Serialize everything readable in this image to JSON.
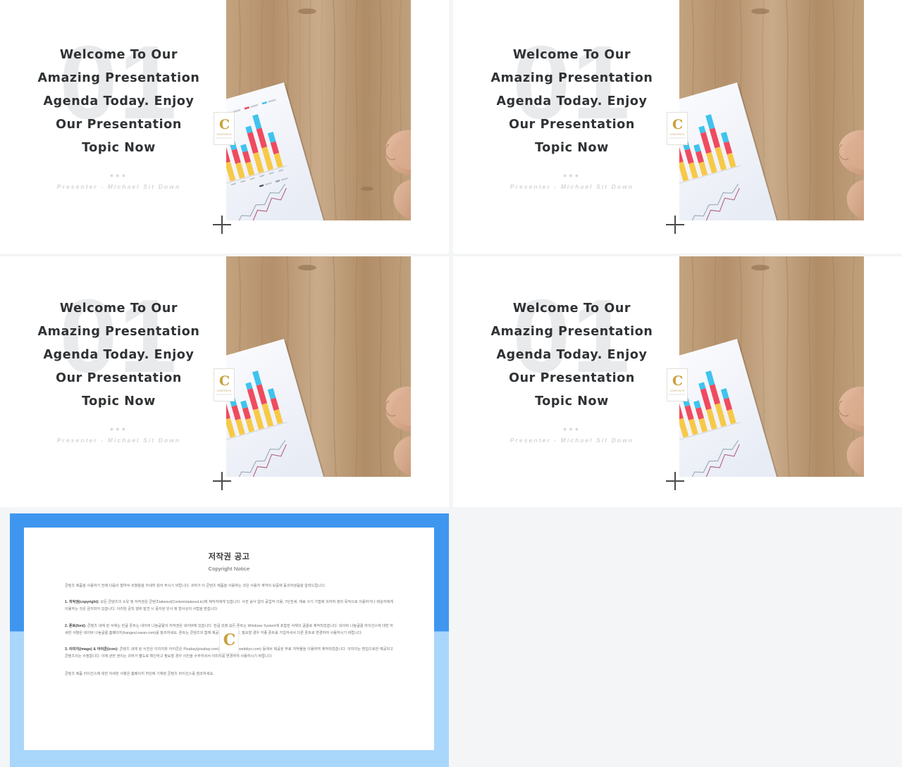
{
  "meta": {
    "background_color": "#f4f5f7",
    "slide_background": "#ffffff",
    "accent_blue_dark": "#3f96ef",
    "accent_blue_light": "#a9d6fb",
    "gold": "#c9a13c"
  },
  "slide": {
    "watermark_number": "01",
    "title_lines": [
      "Welcome To Our",
      "Amazing Presentation",
      "Agenda Today. Enjoy",
      "Our Presentation",
      "Topic Now"
    ],
    "dots": "●●●",
    "presenter": "Presenter - Michael Sit Down",
    "logo": {
      "mark": "C",
      "line1": "CONTENTS",
      "line2": "PRESENTATION"
    },
    "plus_marker": "plus-marker-icon",
    "photo_alt": "wooden-desk-with-bar-chart-report-and-hand"
  },
  "slides": [
    {
      "index": 1,
      "position": "top-left"
    },
    {
      "index": 2,
      "position": "top-right"
    },
    {
      "index": 3,
      "position": "bottom-left"
    },
    {
      "index": 4,
      "position": "bottom-right"
    }
  ],
  "copyright_notice": {
    "title_ko": "저작권 공고",
    "title_en": "Copyright Notice",
    "intro": "콘텐츠 제품을 사용하기 전에 다음의 협약서 조항들을 자세히 읽어 주시기 바랍니다. 귀하가 이 콘텐츠 제품을 사용하는 것은 사용자 계약의 보증에 동의하셨음을 알려드립니다.",
    "items": [
      {
        "label": "1. 저작권(copyright):",
        "text": "모든 콘텐츠의 소유 및 저작권은 콘텐츠takeout(Contentstakeout.kr)에 제작자에게 있습니다. 사전 승낙 없이 공업적 이용, 7단전세, 재료 사기 기법에 의하여 영리 목적으로 이용하거나 제삼자에게 이용하는 것은 금지되어 있습니다. 이러한 금칙 행위 발견 시 중지된 민사 및 형사상의 사법을 받습니다."
      },
      {
        "label": "2. 폰트(font):",
        "text": "콘텐츠 내에 된 서체는 한글 폰트는 네이버 나눔글꼴의 저작권은 네이버에 있습니다. 한글 외에 모든 폰트는 Windows System에 포함된 서체의 글꼴로 제작되었습니다. 네이버 나눔글꼴 라이선스에 대한 자세한 사항은 네이버 나눔글꼴 홈페이지(hangeul.naver.com)를 참조하세요. 폰트는 콘텐츠의 함께 제공되지 않으므로, 필요할 경우 각종 폰트를 가입하셔서 다른 폰트로 변경하여 사용하시기 바랍니다."
      },
      {
        "label": "3. 이미지(image) & 아이콘(icon):",
        "text": "콘텐츠 내에 된 사진은 이미지와 아이콘은 Pixabay(pixabay.com)과 Webdiys(webdiys.com) 등에서 제공된 무료 저작물을 이용하여 제작되었습니다. 이미지는 편집으로만 제공되고 콘텐츠의는 수정합니다. 이에 관한 권리는 귀하가 별도로 확인하고 필요할 경우 사진을 수주하셔서 이미지를 변경하여 사용하시기 바랍니다."
      }
    ],
    "footer": "콘텐츠 제품 라이선스에 대한 자세한 사항은 홈페이지 하단에 기재된 콘텐츠 라이선스를 참조하세요.",
    "watermark_logo": "C"
  }
}
